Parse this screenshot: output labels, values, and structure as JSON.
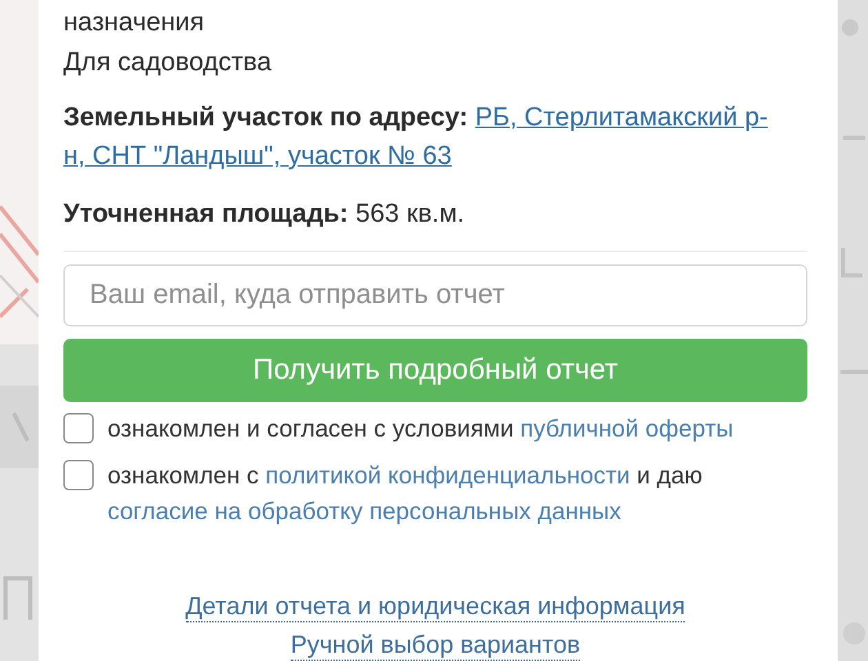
{
  "purpose_lines": [
    "назначения",
    "Для садоводства"
  ],
  "address": {
    "label": "Земельный участок по адресу:",
    "link_lines": [
      "РБ, Стерлитамакский р-",
      "н, СНТ \"Ландыш\", участок № 63"
    ]
  },
  "area": {
    "label": "Уточненная площадь:",
    "value": "563 кв.м."
  },
  "email_field": {
    "placeholder": "Ваш email, куда отправить отчет"
  },
  "submit_button": "Получить подробный отчет",
  "agreements": [
    {
      "checked": false,
      "parts": [
        {
          "kind": "text",
          "text": "ознакомлен и согласен с условиями "
        },
        {
          "kind": "link",
          "text": "публичной оферты"
        }
      ]
    },
    {
      "checked": false,
      "parts": [
        {
          "kind": "text",
          "text": "ознакомлен с "
        },
        {
          "kind": "link",
          "text": "политикой конфиденциальности"
        },
        {
          "kind": "text",
          "text": " и даю "
        },
        {
          "kind": "link",
          "text": "согласие на обработку персональных данных"
        }
      ]
    }
  ],
  "footer_links": [
    "Детали отчета и юридическая информация",
    "Ручной выбор вариантов"
  ]
}
